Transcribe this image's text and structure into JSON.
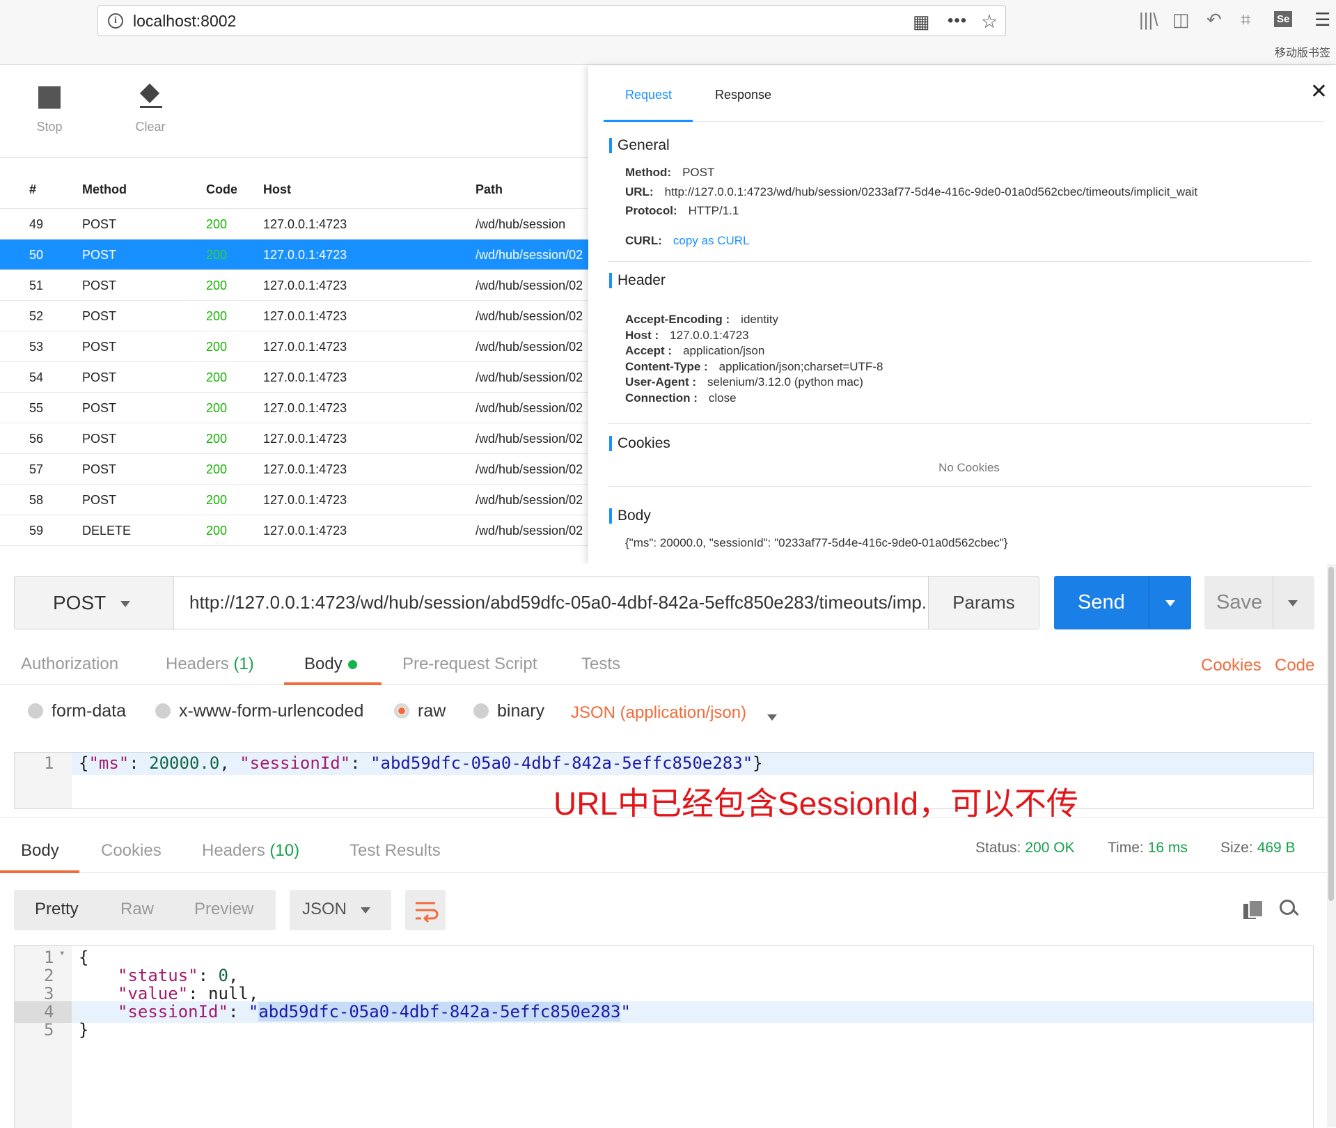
{
  "browser": {
    "url": "localhost:8002",
    "mobile_bookmarks": "移动版书签",
    "icons": [
      "info-icon",
      "qr-code-icon",
      "more-icon",
      "star-icon",
      "library-icon",
      "sidebar-icon",
      "back-arrow-icon",
      "crop-icon",
      "selenium-icon",
      "menu-icon"
    ]
  },
  "toolbar": {
    "stop_label": "Stop",
    "clear_label": "Clear"
  },
  "table": {
    "headers": [
      "#",
      "Method",
      "Code",
      "Host",
      "Path"
    ],
    "rows": [
      {
        "num": "49",
        "method": "POST",
        "code": "200",
        "host": "127.0.0.1:4723",
        "path": "/wd/hub/session",
        "selected": false
      },
      {
        "num": "50",
        "method": "POST",
        "code": "200",
        "host": "127.0.0.1:4723",
        "path": "/wd/hub/session/02",
        "selected": true
      },
      {
        "num": "51",
        "method": "POST",
        "code": "200",
        "host": "127.0.0.1:4723",
        "path": "/wd/hub/session/02",
        "selected": false
      },
      {
        "num": "52",
        "method": "POST",
        "code": "200",
        "host": "127.0.0.1:4723",
        "path": "/wd/hub/session/02",
        "selected": false
      },
      {
        "num": "53",
        "method": "POST",
        "code": "200",
        "host": "127.0.0.1:4723",
        "path": "/wd/hub/session/02",
        "selected": false
      },
      {
        "num": "54",
        "method": "POST",
        "code": "200",
        "host": "127.0.0.1:4723",
        "path": "/wd/hub/session/02",
        "selected": false
      },
      {
        "num": "55",
        "method": "POST",
        "code": "200",
        "host": "127.0.0.1:4723",
        "path": "/wd/hub/session/02",
        "selected": false
      },
      {
        "num": "56",
        "method": "POST",
        "code": "200",
        "host": "127.0.0.1:4723",
        "path": "/wd/hub/session/02",
        "selected": false
      },
      {
        "num": "57",
        "method": "POST",
        "code": "200",
        "host": "127.0.0.1:4723",
        "path": "/wd/hub/session/02",
        "selected": false
      },
      {
        "num": "58",
        "method": "POST",
        "code": "200",
        "host": "127.0.0.1:4723",
        "path": "/wd/hub/session/02",
        "selected": false
      },
      {
        "num": "59",
        "method": "DELETE",
        "code": "200",
        "host": "127.0.0.1:4723",
        "path": "/wd/hub/session/02",
        "selected": false
      }
    ]
  },
  "detail": {
    "tabs": {
      "request": "Request",
      "response": "Response"
    },
    "general": {
      "title": "General",
      "method_label": "Method:",
      "method": "POST",
      "url_label": "URL:",
      "url": "http://127.0.0.1:4723/wd/hub/session/0233af77-5d4e-416c-9de0-01a0d562cbec/timeouts/implicit_wait",
      "protocol_label": "Protocol:",
      "protocol": "HTTP/1.1",
      "curl_label": "CURL:",
      "curl_link": "copy as CURL"
    },
    "header": {
      "title": "Header",
      "items": [
        {
          "key": "Accept-Encoding :",
          "value": "identity"
        },
        {
          "key": "Host :",
          "value": "127.0.0.1:4723"
        },
        {
          "key": "Accept :",
          "value": "application/json"
        },
        {
          "key": "Content-Type :",
          "value": "application/json;charset=UTF-8"
        },
        {
          "key": "User-Agent :",
          "value": "selenium/3.12.0 (python mac)"
        },
        {
          "key": "Connection :",
          "value": "close"
        }
      ]
    },
    "cookies": {
      "title": "Cookies",
      "empty": "No Cookies"
    },
    "body": {
      "title": "Body",
      "content": "{\"ms\": 20000.0, \"sessionId\": \"0233af77-5d4e-416c-9de0-01a0d562cbec\"}"
    }
  },
  "postman": {
    "method": "POST",
    "url": "http://127.0.0.1:4723/wd/hub/session/abd59dfc-05a0-4dbf-842a-5effc850e283/timeouts/imp...",
    "params_label": "Params",
    "send_label": "Send",
    "save_label": "Save",
    "request_tabs": {
      "authorization": "Authorization",
      "headers": "Headers",
      "headers_count": "(1)",
      "body": "Body",
      "prerequest": "Pre-request Script",
      "tests": "Tests"
    },
    "links": {
      "cookies": "Cookies",
      "code": "Code"
    },
    "body_modes": {
      "form_data": "form-data",
      "urlencoded": "x-www-form-urlencoded",
      "raw": "raw",
      "binary": "binary",
      "content_type": "JSON (application/json)"
    },
    "request_body": {
      "line_no": "1",
      "p1": "{",
      "k1": "\"ms\"",
      "p2": ": ",
      "v1": "20000.0",
      "p3": ", ",
      "k2": "\"sessionId\"",
      "p4": ": ",
      "v2": "\"abd59dfc-05a0-4dbf-842a-5effc850e283\"",
      "p5": "}"
    },
    "annotation": "URL中已经包含SessionId，可以不传",
    "response_tabs": {
      "body": "Body",
      "cookies": "Cookies",
      "headers": "Headers",
      "headers_count": "(10)",
      "test_results": "Test Results"
    },
    "status": {
      "status_label": "Status:",
      "status_value": "200 OK",
      "time_label": "Time:",
      "time_value": "16 ms",
      "size_label": "Size:",
      "size_value": "469 B"
    },
    "view_modes": {
      "pretty": "Pretty",
      "raw": "Raw",
      "preview": "Preview",
      "format": "JSON"
    },
    "response_body": {
      "line_numbers": [
        "1",
        "2",
        "3",
        "4",
        "5"
      ],
      "l1": "{",
      "l2_key": "\"status\"",
      "l2_sep": ": ",
      "l2_val": "0",
      "l2_end": ",",
      "l3_key": "\"value\"",
      "l3_sep": ": ",
      "l3_val": "null",
      "l3_end": ",",
      "l4_key": "\"sessionId\"",
      "l4_sep": ": ",
      "l4_q1": "\"",
      "l4_val": "abd59dfc-05a0-4dbf-842a-5effc850e283",
      "l4_q2": "\"",
      "l5": "}"
    },
    "colors": {
      "accent_orange": "#f26b3a",
      "send_blue": "#1a7fe6",
      "status_green": "#16a14a",
      "selection_blue": "#1890ff",
      "annotation_red": "#e0161a"
    }
  }
}
